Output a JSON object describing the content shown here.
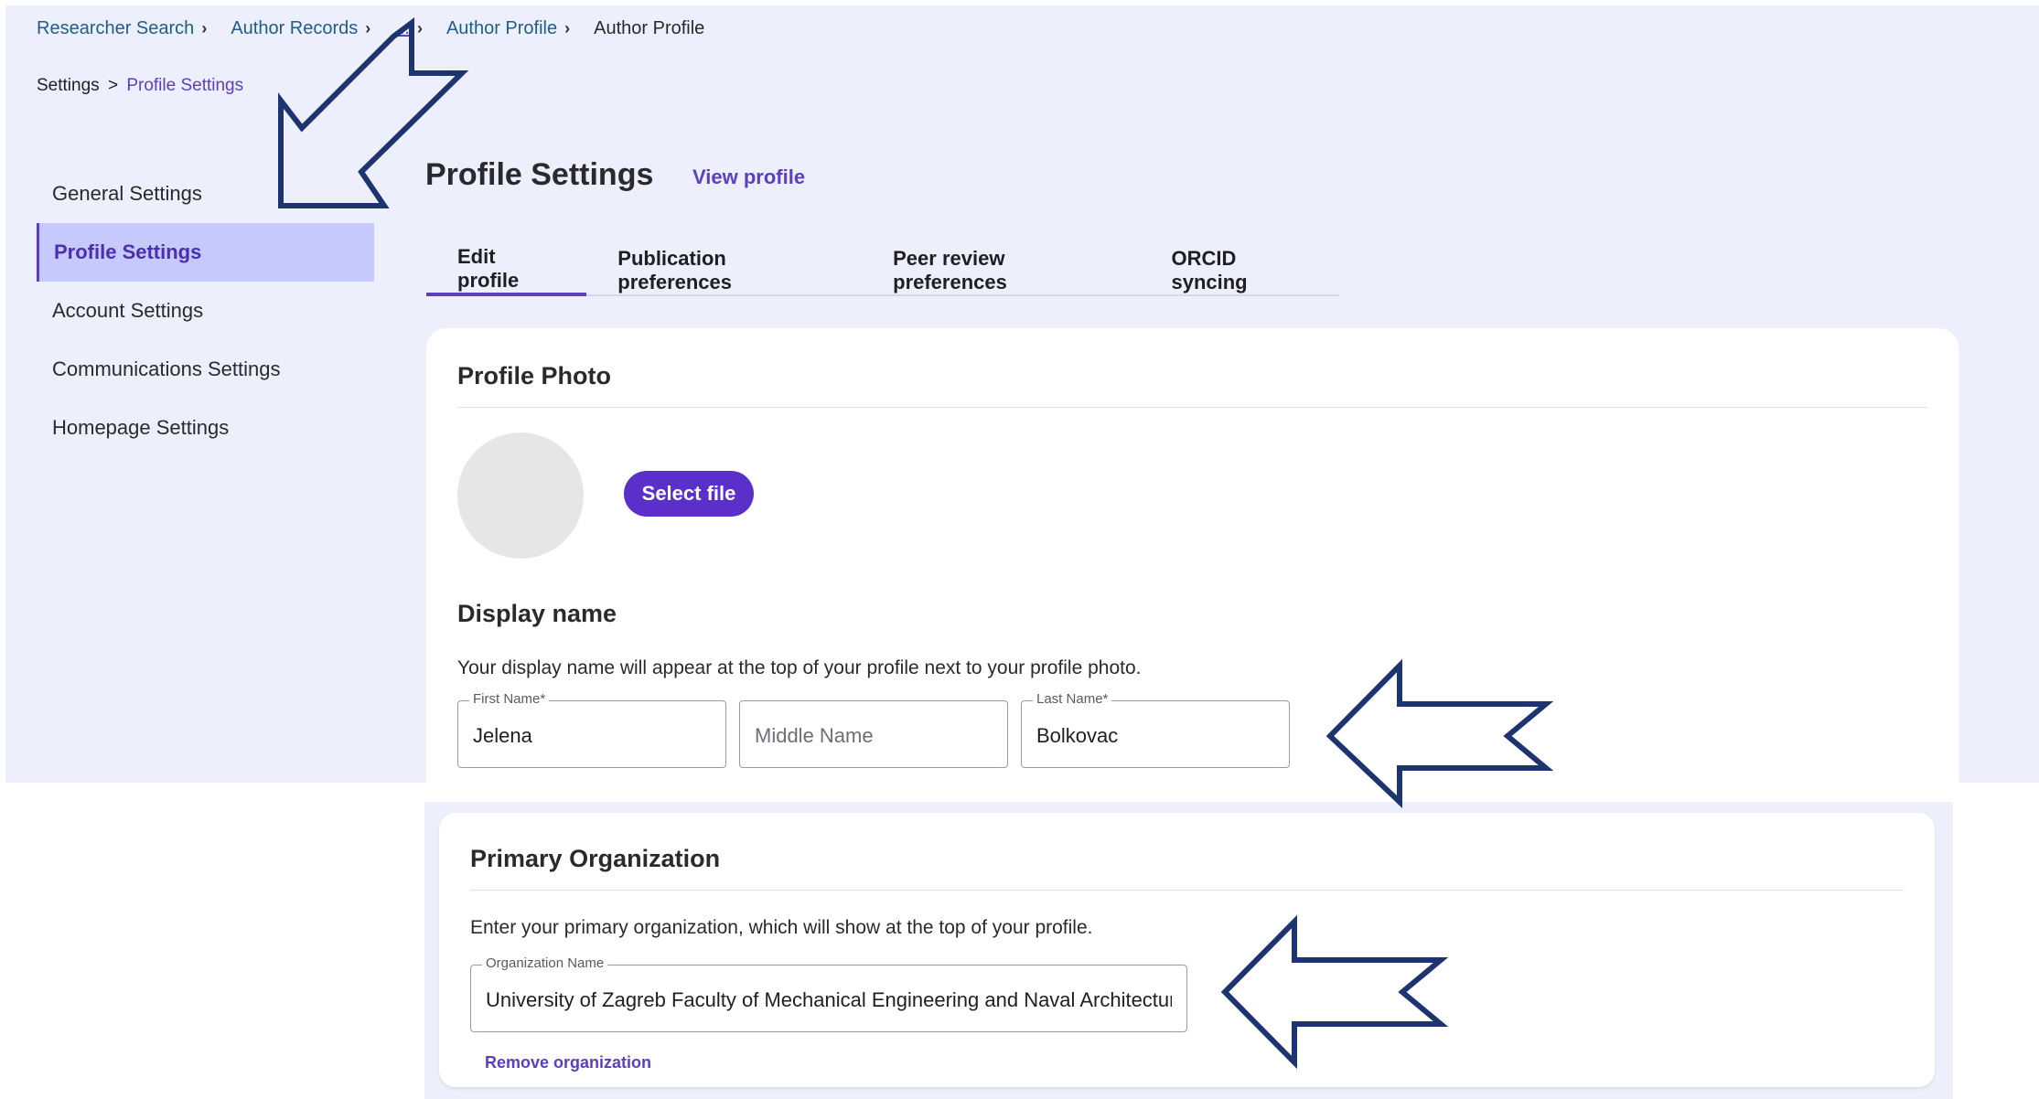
{
  "breadcrumb": {
    "items": [
      "Researcher Search",
      "Author Records",
      "...",
      "Author Profile"
    ],
    "current": "Author Profile"
  },
  "settings_crumb": {
    "root": "Settings",
    "separator": ">",
    "leaf": "Profile Settings"
  },
  "sidebar": {
    "items": [
      {
        "label": "General Settings"
      },
      {
        "label": "Profile Settings",
        "active": true
      },
      {
        "label": "Account Settings"
      },
      {
        "label": "Communications Settings"
      },
      {
        "label": "Homepage Settings"
      }
    ]
  },
  "header": {
    "title": "Profile Settings",
    "view_profile_label": "View profile"
  },
  "tabs": [
    {
      "label": "Edit profile",
      "active": true
    },
    {
      "label": "Publication preferences"
    },
    {
      "label": "Peer review preferences"
    },
    {
      "label": "ORCID syncing"
    }
  ],
  "profile_photo": {
    "title": "Profile Photo",
    "select_file_label": "Select file"
  },
  "display_name": {
    "title": "Display name",
    "help": "Your display name will appear at the top of your profile next to your profile photo.",
    "first_name": {
      "label": "First Name*",
      "value": "Jelena"
    },
    "middle_name": {
      "placeholder": "Middle Name",
      "value": ""
    },
    "last_name": {
      "label": "Last Name*",
      "value": "Bolkovac"
    }
  },
  "primary_org": {
    "title": "Primary Organization",
    "help": "Enter your primary organization, which will show at the top of your profile.",
    "org_name": {
      "label": "Organization Name",
      "value": "University of Zagreb Faculty of Mechanical Engineering and Naval Architecture"
    },
    "remove_label": "Remove organization"
  },
  "colors": {
    "accent": "#5b3fc1",
    "button": "#5b2fc9",
    "active_nav_bg": "#c5c9fb",
    "panel_bg": "#eeeffc",
    "annotation_arrow": "#1e3470"
  },
  "annotations": [
    "arrow-pointing-to-profile-settings",
    "arrow-pointing-to-display-name",
    "arrow-pointing-to-organization"
  ]
}
